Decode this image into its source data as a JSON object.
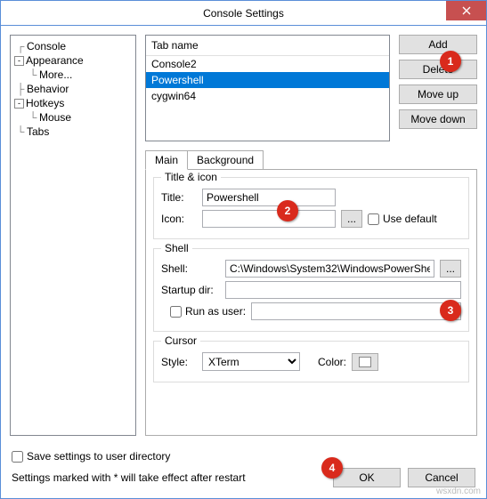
{
  "window": {
    "title": "Console Settings"
  },
  "tree": {
    "items": {
      "console": "Console",
      "appearance": "Appearance",
      "more": "More...",
      "behavior": "Behavior",
      "hotkeys": "Hotkeys",
      "mouse": "Mouse",
      "tabs": "Tabs"
    }
  },
  "listbox": {
    "header": "Tab name",
    "items": [
      "Console2",
      "Powershell",
      "cygwin64"
    ],
    "selected_index": 1
  },
  "buttons": {
    "add": "Add",
    "delete": "Delete",
    "move_up": "Move up",
    "move_down": "Move down"
  },
  "tabs": {
    "main": "Main",
    "background": "Background"
  },
  "group_title_icon": {
    "legend": "Title & icon",
    "title_label": "Title:",
    "title_value": "Powershell",
    "icon_label": "Icon:",
    "icon_value": "",
    "browse": "...",
    "use_default": "Use default"
  },
  "group_shell": {
    "legend": "Shell",
    "shell_label": "Shell:",
    "shell_value": "C:\\Windows\\System32\\WindowsPowerShe",
    "browse": "...",
    "startup_label": "Startup dir:",
    "startup_value": "",
    "run_as_user": "Run as user:",
    "run_as_user_value": ""
  },
  "group_cursor": {
    "legend": "Cursor",
    "style_label": "Style:",
    "style_value": "XTerm",
    "color_label": "Color:"
  },
  "footer": {
    "save_settings": "Save settings to user directory",
    "restart_note": "Settings marked with * will take effect after restart",
    "ok": "OK",
    "cancel": "Cancel"
  },
  "badges": {
    "b1": "1",
    "b2": "2",
    "b3": "3",
    "b4": "4"
  },
  "watermark": "wsxdn.com"
}
